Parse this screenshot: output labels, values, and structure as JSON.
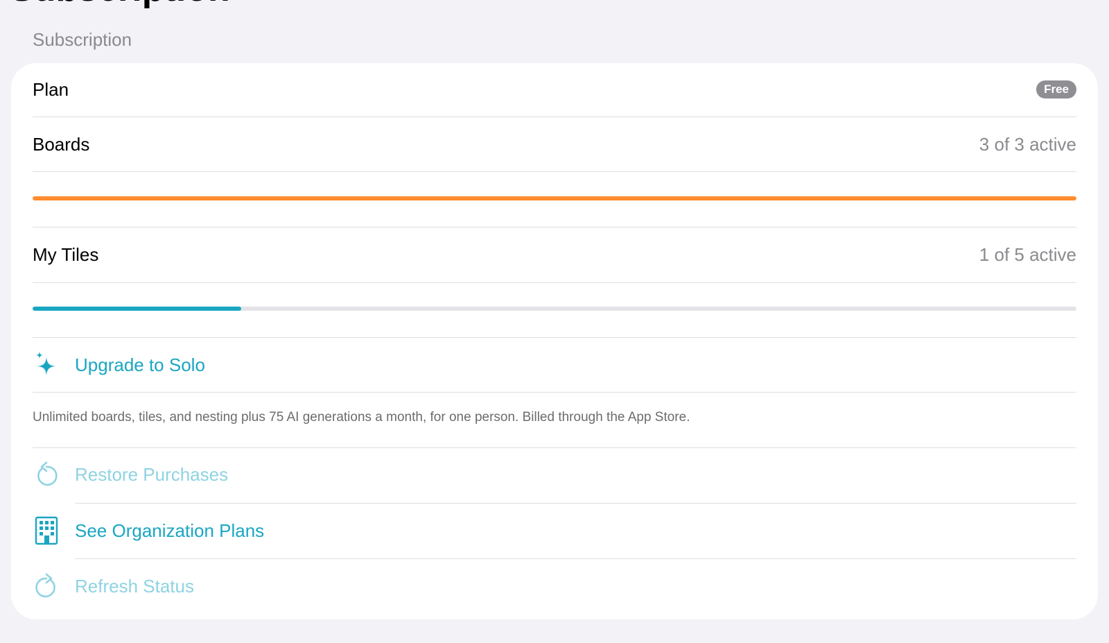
{
  "page": {
    "title": "Subscription",
    "section_header": "Subscription"
  },
  "plan": {
    "label": "Plan",
    "badge": "Free"
  },
  "boards": {
    "label": "Boards",
    "value": "3 of 3 active",
    "progress": 1.0,
    "progress_color": "#ff8c2e"
  },
  "tiles": {
    "label": "My Tiles",
    "value": "1 of 5 active",
    "progress": 0.2,
    "progress_color": "#1aa6c2"
  },
  "actions": {
    "upgrade": {
      "label": "Upgrade to Solo",
      "icon": "sparkles-icon"
    },
    "restore": {
      "label": "Restore Purchases",
      "icon": "restore-arrow-icon"
    },
    "org_plans": {
      "label": "See Organization Plans",
      "icon": "building-icon"
    },
    "refresh": {
      "label": "Refresh Status",
      "icon": "refresh-arrow-icon"
    }
  },
  "footnote": "Unlimited boards, tiles, and nesting plus 75 AI generations a month, for one person. Billed through the App Store.",
  "colors": {
    "accent": "#1aa6c2",
    "accent_disabled": "#8fd3e2",
    "boards_bar": "#ff8c2e",
    "background": "#f2f2f7"
  }
}
